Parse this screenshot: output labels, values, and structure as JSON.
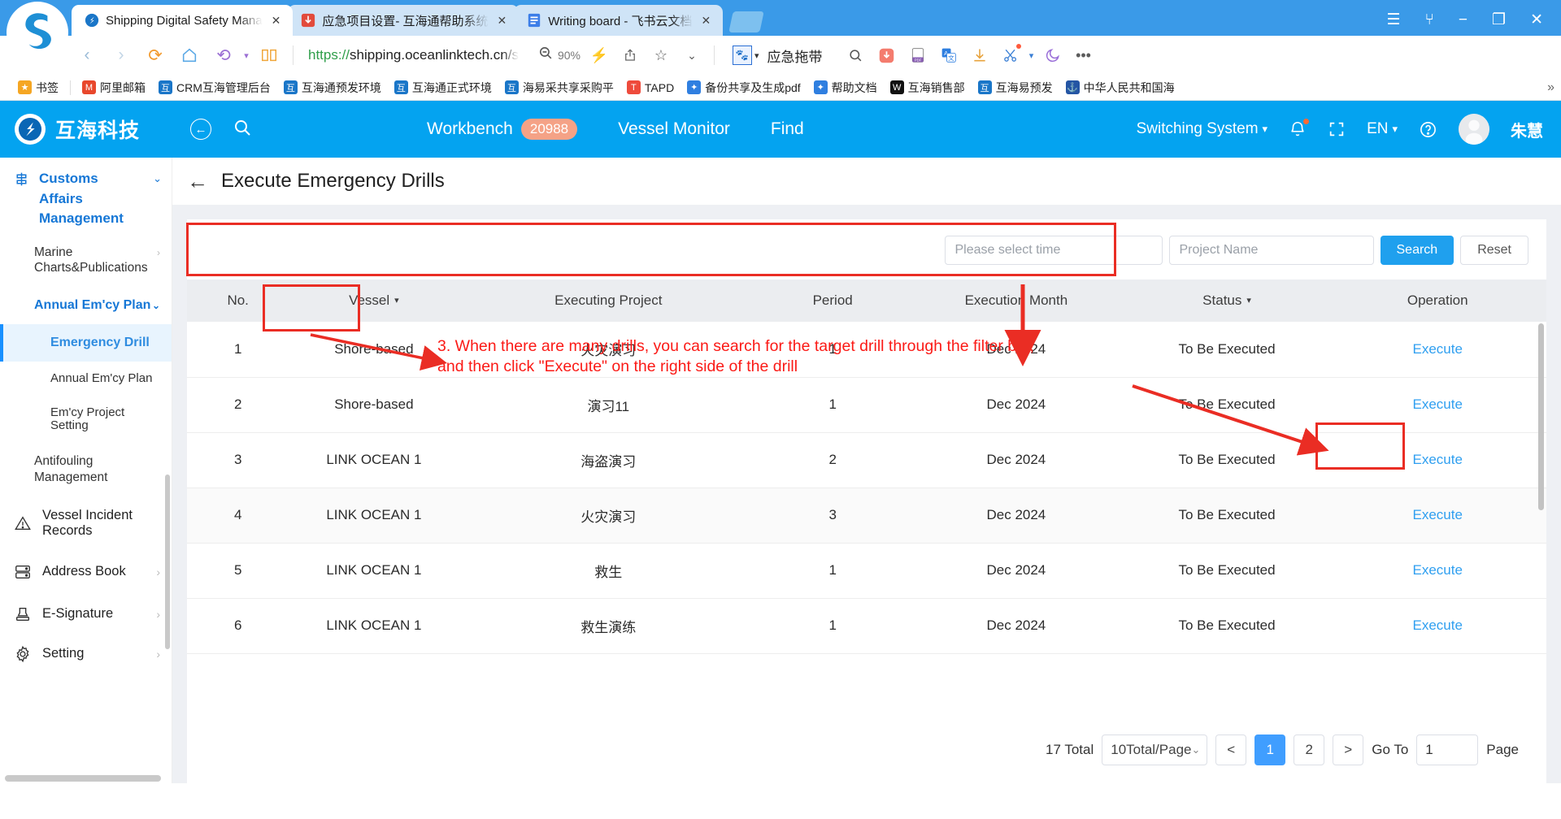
{
  "browser": {
    "tabs": [
      {
        "title": "Shipping Digital Safety Mana",
        "close": "✕",
        "favicon": "shipping-logo-icon",
        "active": true
      },
      {
        "title": "应急项目设置- 互海通帮助系统",
        "close": "✕",
        "favicon": "pdf-icon",
        "active": false
      },
      {
        "title": "Writing board - 飞书云文档",
        "close": "✕",
        "favicon": "doc-icon",
        "active": false
      }
    ],
    "window_controls": [
      "menu-icon",
      "shirt-icon",
      "minimize-icon",
      "restore-icon",
      "close-icon"
    ],
    "nav": {
      "back": "‹",
      "forward": "›",
      "reload": "⟳",
      "home": "⌂",
      "history": "⟲",
      "history_caret": "▾",
      "reader": "▯▯"
    },
    "url": {
      "scheme": "https://",
      "host": "shipping.oceanlinktech.cn/",
      "rest": "s"
    },
    "zoom": {
      "icon": "zoom-out-icon",
      "level": "90%"
    },
    "toolbar_right": {
      "lightning": "⚡",
      "share": "↥",
      "star": "☆",
      "chevron": "⌄",
      "paw": "🐾",
      "paw_caret": "▾",
      "engine_name": "应急拖带",
      "search": "search-icon",
      "pdf": "PDF",
      "docread": "doc-icon",
      "translate": "translate-icon",
      "download": "↓",
      "scissors": "✂",
      "caret_small": "▾",
      "moon": "☾",
      "more": "•••"
    },
    "bookmarks": [
      {
        "label": "书签",
        "icon": "★",
        "color": "#f5a623"
      },
      {
        "label": "阿里邮箱",
        "icon": "M",
        "color": "#e8472c"
      },
      {
        "label": "CRM互海管理后台",
        "icon": "互",
        "color": "#1a76c8"
      },
      {
        "label": "互海通预发环境",
        "icon": "互",
        "color": "#1a76c8"
      },
      {
        "label": "互海通正式环境",
        "icon": "互",
        "color": "#1a76c8"
      },
      {
        "label": "海易采共享采购平",
        "icon": "互",
        "color": "#1a76c8"
      },
      {
        "label": "TAPD",
        "icon": "T",
        "color": "#ee4b3c"
      },
      {
        "label": "备份共享及生成pdf",
        "icon": "✦",
        "color": "#2f7fe0"
      },
      {
        "label": "帮助文档",
        "icon": "✦",
        "color": "#2f7fe0"
      },
      {
        "label": "互海销售部",
        "icon": "W",
        "color": "#111111"
      },
      {
        "label": "互海易预发",
        "icon": "互",
        "color": "#1a76c8"
      },
      {
        "label": "中华人民共和国海",
        "icon": "⚓",
        "color": "#2455a4"
      }
    ],
    "bookmarks_overflow": "»"
  },
  "appbar": {
    "logo_text": "互海科技",
    "logo_icon": "company-logo-icon",
    "collapse_icon": "←",
    "search_icon": "search-icon",
    "nav": [
      {
        "label": "Workbench",
        "badge": "20988"
      },
      {
        "label": "Vessel Monitor",
        "badge": ""
      },
      {
        "label": "Find",
        "badge": ""
      }
    ],
    "switching_system": "Switching System",
    "switching_caret": "▾",
    "bell_icon": "bell-icon",
    "fullscreen_icon": "fullscreen-icon",
    "lang": "EN",
    "lang_caret": "▾",
    "help_icon": "?",
    "user_name": "朱慧"
  },
  "sidebar": {
    "group": {
      "label": "Customs Affairs Management",
      "icon": "customs-icon",
      "chevron": "⌄"
    },
    "sub_items": [
      {
        "label": "Marine Charts&Publications",
        "chevron": "›",
        "style": "plain"
      },
      {
        "label": "Annual Em'cy Plan",
        "chevron": "⌄",
        "style": "bold"
      }
    ],
    "lvl3_items": [
      {
        "label": "Emergency Drill",
        "selected": true
      },
      {
        "label": "Annual Em'cy Plan",
        "selected": false
      },
      {
        "label": "Em'cy Project Setting",
        "selected": false
      }
    ],
    "sub_items2": [
      {
        "label": "Antifouling Management",
        "chevron": "",
        "style": "plain"
      }
    ],
    "items": [
      {
        "label": "Vessel Incident Records",
        "icon": "warning-triangle-icon",
        "chevron": ""
      },
      {
        "label": "Address Book",
        "icon": "address-book-icon",
        "chevron": "›"
      },
      {
        "label": "E-Signature",
        "icon": "stamp-icon",
        "chevron": "›"
      },
      {
        "label": "Setting",
        "icon": "gear-icon",
        "chevron": "›"
      }
    ]
  },
  "page": {
    "back_icon": "←",
    "title": "Execute Emergency Drills"
  },
  "filter": {
    "time_placeholder": "Please select time",
    "project_placeholder": "Project Name",
    "search_label": "Search",
    "reset_label": "Reset"
  },
  "table": {
    "columns": [
      {
        "label": "No.",
        "sortable": false
      },
      {
        "label": "Vessel",
        "sortable": true,
        "caret": "▾"
      },
      {
        "label": "Executing Project",
        "sortable": false
      },
      {
        "label": "Period",
        "sortable": false
      },
      {
        "label": "Execution Month",
        "sortable": false
      },
      {
        "label": "Status",
        "sortable": true,
        "caret": "▾"
      },
      {
        "label": "Operation",
        "sortable": false
      }
    ],
    "rows": [
      {
        "no": "1",
        "vessel": "Shore-based",
        "project": "火灾演习",
        "period": "1",
        "month": "Dec 2024",
        "status": "To Be Executed",
        "action": "Execute"
      },
      {
        "no": "2",
        "vessel": "Shore-based",
        "project": "演习11",
        "period": "1",
        "month": "Dec 2024",
        "status": "To Be Executed",
        "action": "Execute"
      },
      {
        "no": "3",
        "vessel": "LINK OCEAN 1",
        "project": "海盗演习",
        "period": "2",
        "month": "Dec 2024",
        "status": "To Be Executed",
        "action": "Execute"
      },
      {
        "no": "4",
        "vessel": "LINK OCEAN 1",
        "project": "火灾演习",
        "period": "3",
        "month": "Dec 2024",
        "status": "To Be Executed",
        "action": "Execute"
      },
      {
        "no": "5",
        "vessel": "LINK OCEAN 1",
        "project": "救生",
        "period": "1",
        "month": "Dec 2024",
        "status": "To Be Executed",
        "action": "Execute"
      },
      {
        "no": "6",
        "vessel": "LINK OCEAN 1",
        "project": "救生演练",
        "period": "1",
        "month": "Dec 2024",
        "status": "To Be Executed",
        "action": "Execute"
      }
    ]
  },
  "pagination": {
    "total": "17 Total",
    "page_size": "10Total/Page",
    "page_size_caret": "⌄",
    "prev": "<",
    "pages": [
      "1",
      "2"
    ],
    "current_page": "1",
    "next": ">",
    "goto_label": "Go To",
    "goto_value": "1",
    "page_word": "Page"
  },
  "annotation": {
    "line1": "3. When there are many drills, you can search for the target drill through the filter bar,",
    "line2": "and then click \"Execute\" on the right side of the drill",
    "color": "#fb1a16"
  }
}
